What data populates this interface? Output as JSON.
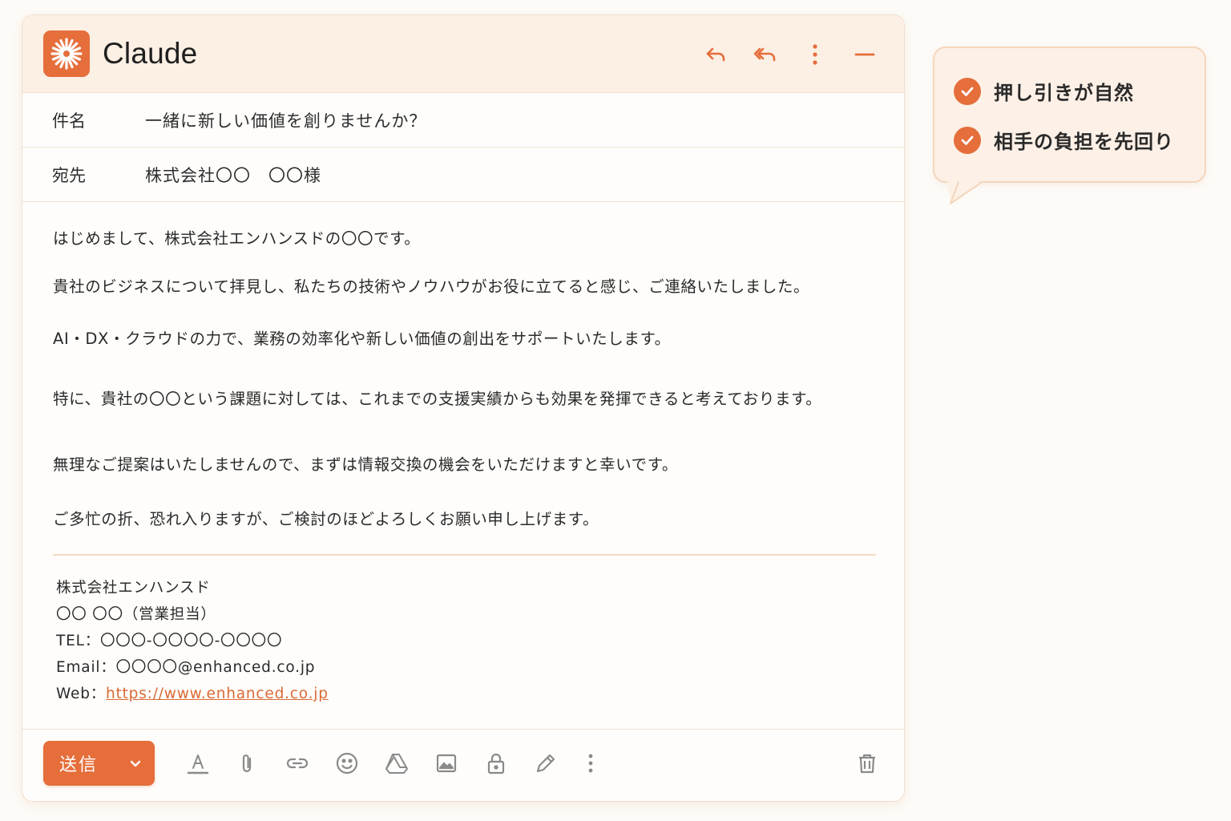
{
  "app": {
    "title": "Claude"
  },
  "header": {
    "icons": [
      "reply-icon",
      "reply-all-icon",
      "more-vertical-icon",
      "minimize-icon"
    ]
  },
  "fields": {
    "subject_label": "件名",
    "subject_value": "一緒に新しい価値を創りませんか？",
    "to_label": "宛先",
    "to_value": "株式会社〇〇　〇〇様"
  },
  "body": {
    "lines": [
      "はじめまして、株式会社エンハンスドの〇〇です。",
      "貴社のビジネスについて拝見し、私たちの技術やノウハウがお役に立てると感じ、ご連絡いたしました。",
      "AI・DX・クラウドの力で、業務の効率化や新しい価値の創出をサポートいたします。",
      "特に、貴社の〇〇という課題に対しては、これまでの支援実績からも効果を発揮できると考えております。",
      "無理なご提案はいたしませんので、まずは情報交換の機会をいただけますと幸いです。",
      "ご多忙の折、恐れ入りますが、ご検討のほどよろしくお願い申し上げます。"
    ]
  },
  "signature": {
    "company": "株式会社エンハンスド",
    "name": "〇〇 〇〇（営業担当）",
    "tel": "TEL：〇〇〇-〇〇〇〇-〇〇〇〇",
    "email": "Email：〇〇〇〇@enhanced.co.jp",
    "web_label": "Web：",
    "web_url": "https://www.enhanced.co.jp"
  },
  "toolbar": {
    "send_label": "送信",
    "icons": [
      "text-format-icon",
      "attachment-icon",
      "link-icon",
      "emoji-icon",
      "drive-icon",
      "image-icon",
      "lock-icon",
      "pen-icon",
      "more-vertical-icon",
      "trash-icon"
    ]
  },
  "callout": {
    "items": [
      "押し引きが自然",
      "相手の負担を先回り"
    ]
  },
  "colors": {
    "accent": "#e56e3b",
    "header_bg": "#fcefe4",
    "callout_bg": "#fdf0e6"
  }
}
